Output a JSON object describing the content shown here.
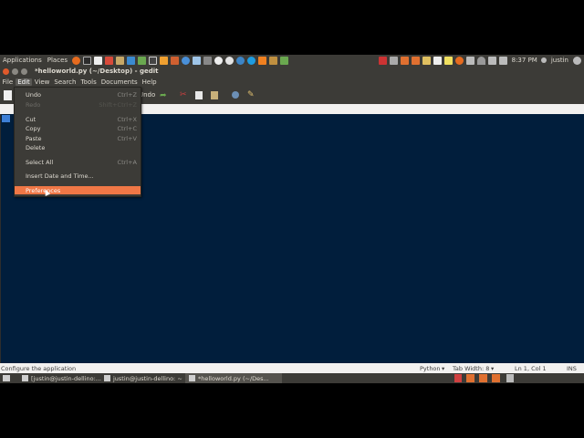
{
  "top_panel": {
    "applications": "Applications",
    "places": "Places",
    "time": "8:37 PM",
    "user": "justin"
  },
  "window": {
    "title": "*helloworld.py (~/Desktop) - gedit"
  },
  "menubar": [
    "File",
    "Edit",
    "View",
    "Search",
    "Tools",
    "Documents",
    "Help"
  ],
  "toolbar": {
    "undo_label": "Undo"
  },
  "edit_menu": {
    "items": [
      {
        "label": "Undo",
        "accel": "Ctrl+Z"
      },
      {
        "label": "Redo",
        "accel": "Shift+Ctrl+Z"
      },
      {
        "label": "Cut",
        "accel": "Ctrl+X"
      },
      {
        "label": "Copy",
        "accel": "Ctrl+C"
      },
      {
        "label": "Paste",
        "accel": "Ctrl+V"
      },
      {
        "label": "Delete",
        "accel": ""
      },
      {
        "label": "Select All",
        "accel": "Ctrl+A"
      },
      {
        "label": "Insert Date and Time...",
        "accel": ""
      },
      {
        "label": "Preferences",
        "accel": ""
      }
    ]
  },
  "statusbar": {
    "message": "Configure the application",
    "language": "Python",
    "tab_width": "Tab Width: 8",
    "position": "Ln 1, Col 1",
    "mode": "INS"
  },
  "taskbar": {
    "tasks": [
      {
        "label": "[justin@justin-dellino:..."
      },
      {
        "label": "justin@justin-dellino: ~"
      },
      {
        "label": "*helloworld.py (~/Des..."
      }
    ]
  },
  "colors": {
    "panel": "#3c3b37",
    "editor_bg": "#011e3c",
    "highlight": "#f07746"
  }
}
